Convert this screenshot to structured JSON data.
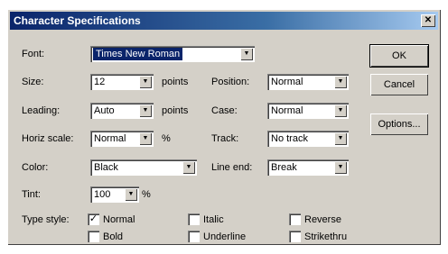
{
  "window": {
    "title": "Character Specifications",
    "close_glyph": "✕"
  },
  "labels": {
    "font": "Font:",
    "size": "Size:",
    "leading": "Leading:",
    "horiz_scale": "Horiz scale:",
    "color": "Color:",
    "tint": "Tint:",
    "type_style": "Type style:",
    "position": "Position:",
    "case": "Case:",
    "track": "Track:",
    "line_end": "Line end:"
  },
  "units": {
    "points1": "points",
    "points2": "points",
    "percent1": "%",
    "percent2": "%"
  },
  "fields": {
    "font": "Times New Roman",
    "size": "12",
    "leading": "Auto",
    "horiz_scale": "Normal",
    "color": "Black",
    "tint": "100",
    "position": "Normal",
    "case": "Normal",
    "track": "No track",
    "line_end": "Break"
  },
  "arrow_glyph": "▼",
  "type_style": [
    {
      "label": "Normal",
      "checked": true
    },
    {
      "label": "Italic",
      "checked": false
    },
    {
      "label": "Reverse",
      "checked": false
    },
    {
      "label": "Bold",
      "checked": false
    },
    {
      "label": "Underline",
      "checked": false
    },
    {
      "label": "Strikethru",
      "checked": false
    }
  ],
  "check_glyph": "✓",
  "buttons": {
    "ok": "OK",
    "cancel": "Cancel",
    "options": "Options..."
  }
}
